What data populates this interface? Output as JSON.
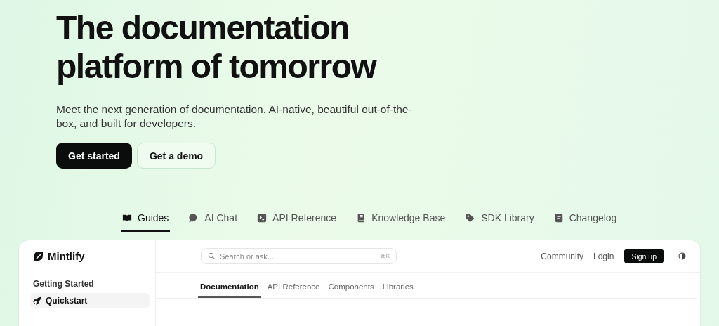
{
  "hero": {
    "title": "The documentation platform of tomorrow",
    "subtitle": "Meet the next generation of documentation. AI-native, beautiful out-of-the-box, and built for developers.",
    "buttons": [
      {
        "label": "Get started",
        "kind": "primary"
      },
      {
        "label": "Get a demo",
        "kind": "secondary"
      }
    ]
  },
  "tabs": [
    {
      "label": "Guides",
      "selected": true
    },
    {
      "label": "AI Chat",
      "selected": false
    },
    {
      "label": "API Reference",
      "selected": false
    },
    {
      "label": "Knowledge Base",
      "selected": false
    },
    {
      "label": "SDK Library",
      "selected": false
    },
    {
      "label": "Changelog",
      "selected": false
    }
  ],
  "preview": {
    "logo": "Mintlify",
    "search": {
      "placeholder": "Search or ask...",
      "shortcut": "⌘K"
    },
    "nav_links": [
      "Community",
      "Login"
    ],
    "signup": "Sign up",
    "subtabs": [
      {
        "label": "Documentation",
        "selected": true
      },
      {
        "label": "API Reference",
        "selected": false
      },
      {
        "label": "Components",
        "selected": false
      },
      {
        "label": "Libraries",
        "selected": false
      }
    ],
    "sidebar": {
      "section": "Getting Started",
      "items": [
        {
          "label": "Quickstart",
          "selected": true
        }
      ]
    }
  }
}
